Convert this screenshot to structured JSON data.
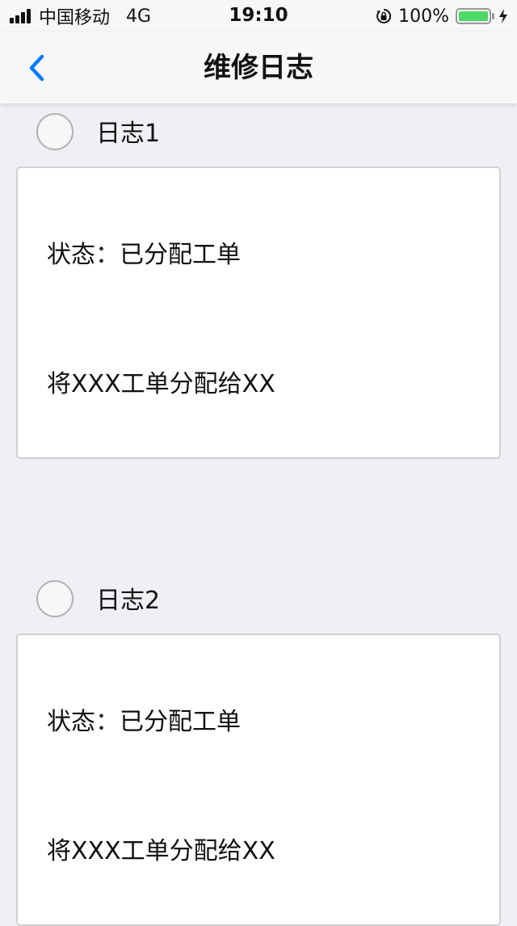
{
  "status_bar": {
    "carrier": "中国移动",
    "network": "4G",
    "time": "19:10",
    "battery": "100%",
    "battery_color": "#4cd964"
  },
  "nav": {
    "title": "维修日志",
    "back_icon": "chevron-left-icon",
    "accent": "#007aff"
  },
  "logs": [
    {
      "title": "日志1",
      "status": "状态：已分配工单",
      "description": "将XXX工单分配给XX"
    },
    {
      "title": "日志2",
      "status": "状态：已分配工单",
      "description": "将XXX工单分配给XX"
    }
  ]
}
